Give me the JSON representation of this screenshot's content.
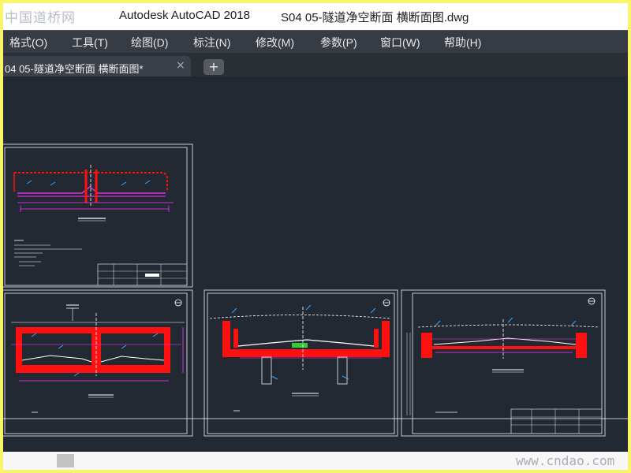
{
  "watermark_top": "中国道桥网",
  "window": {
    "app_name": "Autodesk AutoCAD 2018",
    "file_name": "S04 05-隧道净空断面 横断面图.dwg"
  },
  "menu": [
    "格式(O)",
    "工具(T)",
    "绘图(D)",
    "标注(N)",
    "修改(M)",
    "参数(P)",
    "窗口(W)",
    "帮助(H)"
  ],
  "tab": {
    "label": "04 05-隧道净空断面 横断面图*",
    "close_glyph": "×",
    "add_glyph": "+"
  },
  "watermark_bottom": "www.cndao.com",
  "colors": {
    "canvas": "#222933",
    "sheet_border": "#c8c8c8",
    "structure": "#ff1010",
    "dimension": "#ff33ff",
    "annotation": "#33aaff",
    "centerline": "#ffffff",
    "cut_line": "#ffffff"
  }
}
